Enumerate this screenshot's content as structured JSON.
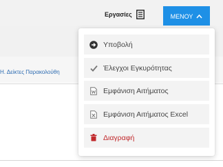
{
  "header": {
    "tasks_label": "Εργασίες",
    "menu_label": "ΜΕΝΟΥ"
  },
  "breadcrumb": "Η. Δείκτες Παρακολούθη",
  "menu": {
    "items": [
      {
        "label": "Υποβολή",
        "icon": "arrow-circle-right-icon"
      },
      {
        "label": "Έλεγχοι Εγκυρότητας",
        "icon": "checkmark-icon"
      },
      {
        "label": "Εμφάνιση Αιτήματος",
        "icon": "word-file-icon"
      },
      {
        "label": "Εμφάνιση Αιτήματος Excel",
        "icon": "excel-file-icon"
      },
      {
        "label": "Διαγραφή",
        "icon": "trash-icon"
      }
    ]
  },
  "colors": {
    "accent": "#1e90e6",
    "danger": "#c0282b",
    "link": "#2f6db2"
  }
}
